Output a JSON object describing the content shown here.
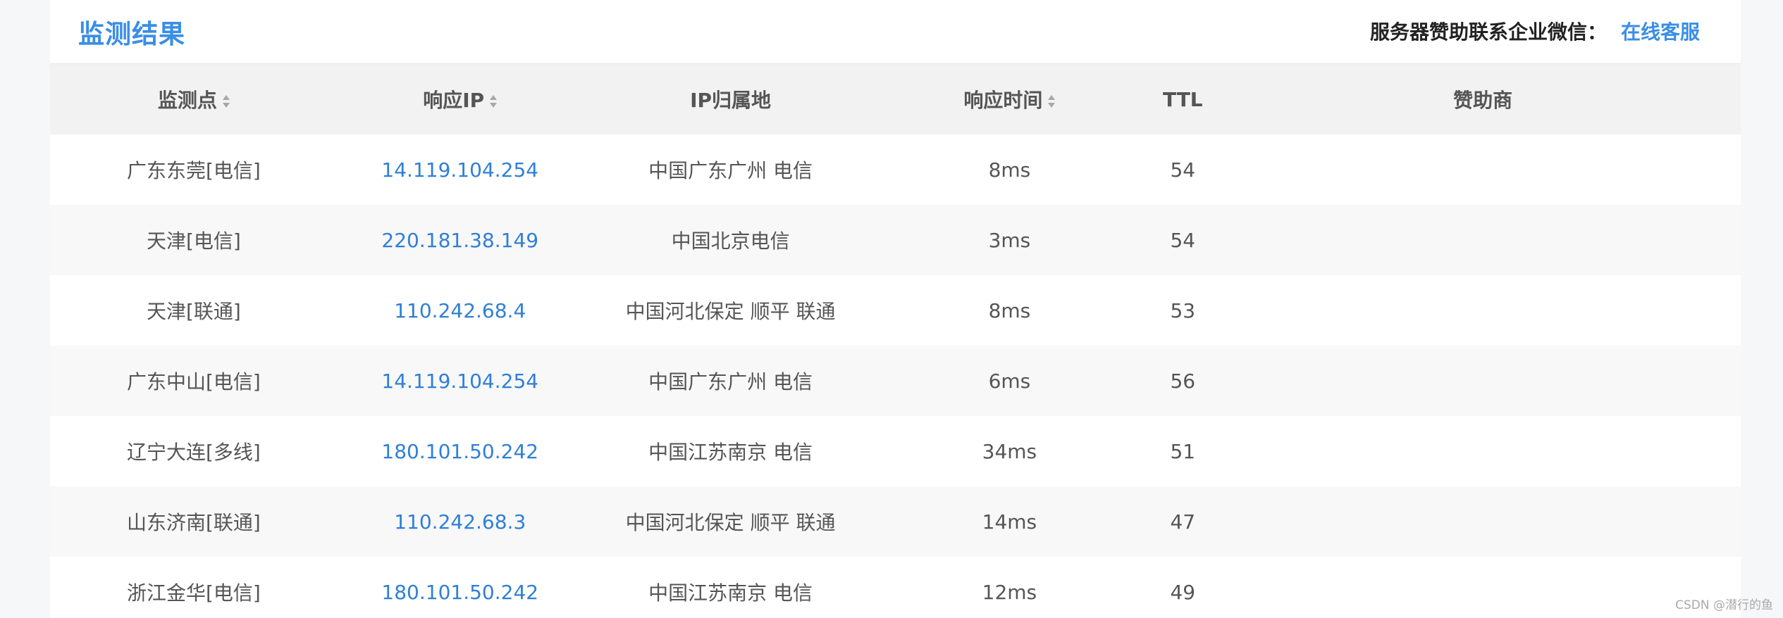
{
  "header": {
    "title": "监测结果",
    "sponsor_text": "服务器赞助联系企业微信：",
    "sponsor_link": "在线客服"
  },
  "table": {
    "columns": [
      {
        "label": "监测点",
        "sortable": true
      },
      {
        "label": "响应IP",
        "sortable": true
      },
      {
        "label": "IP归属地",
        "sortable": false
      },
      {
        "label": "响应时间",
        "sortable": true
      },
      {
        "label": "TTL",
        "sortable": false
      },
      {
        "label": "赞助商",
        "sortable": false
      }
    ],
    "rows": [
      {
        "point": "广东东莞[电信]",
        "ip": "14.119.104.254",
        "location": "中国广东广州 电信",
        "time": "8ms",
        "ttl": "54",
        "sponsor": ""
      },
      {
        "point": "天津[电信]",
        "ip": "220.181.38.149",
        "location": "中国北京电信",
        "time": "3ms",
        "ttl": "54",
        "sponsor": ""
      },
      {
        "point": "天津[联通]",
        "ip": "110.242.68.4",
        "location": "中国河北保定 顺平 联通",
        "time": "8ms",
        "ttl": "53",
        "sponsor": ""
      },
      {
        "point": "广东中山[电信]",
        "ip": "14.119.104.254",
        "location": "中国广东广州 电信",
        "time": "6ms",
        "ttl": "56",
        "sponsor": ""
      },
      {
        "point": "辽宁大连[多线]",
        "ip": "180.101.50.242",
        "location": "中国江苏南京 电信",
        "time": "34ms",
        "ttl": "51",
        "sponsor": ""
      },
      {
        "point": "山东济南[联通]",
        "ip": "110.242.68.3",
        "location": "中国河北保定 顺平 联通",
        "time": "14ms",
        "ttl": "47",
        "sponsor": ""
      },
      {
        "point": "浙江金华[电信]",
        "ip": "180.101.50.242",
        "location": "中国江苏南京 电信",
        "time": "12ms",
        "ttl": "49",
        "sponsor": ""
      }
    ]
  },
  "watermark": "CSDN @潜行的鱼",
  "colors": {
    "accent": "#3a8ee6",
    "ip_link": "#2f7fd6",
    "header_bg": "#f2f2f2",
    "stripe_bg": "#f8f8f8",
    "page_bg": "#f6f7f9"
  }
}
